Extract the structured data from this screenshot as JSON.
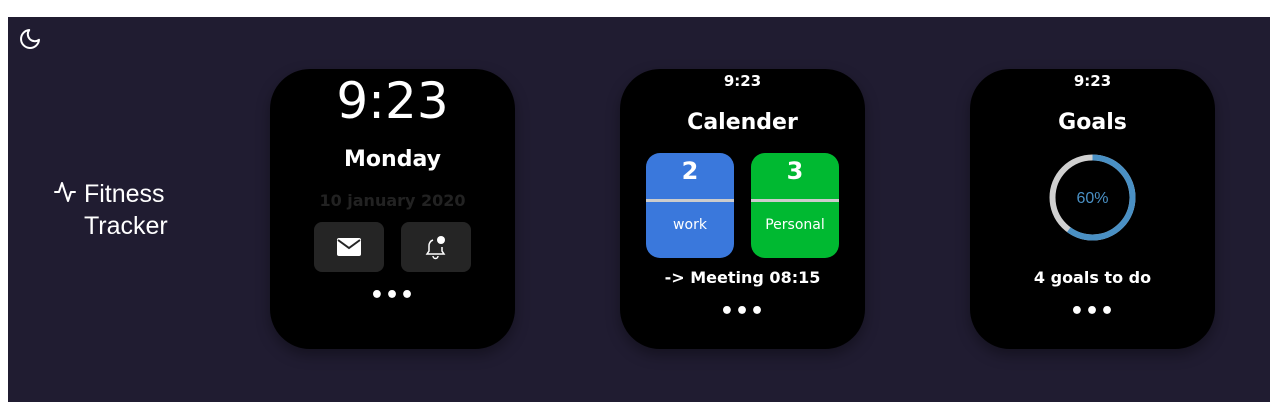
{
  "brand": {
    "title": "Fitness Tracker",
    "icon": "activity-icon"
  },
  "theme_toggle": {
    "icon": "moon-icon"
  },
  "colors": {
    "background": "#201c31",
    "work": "#3a78dc",
    "personal": "#00b931",
    "progress": "#4a90c4",
    "track": "#d0d0d0"
  },
  "home": {
    "time": "9:23",
    "day": "Monday",
    "date": "10 january 2020",
    "mail_icon": "mail-icon",
    "bell_icon": "bell-notification-icon",
    "more": "•••"
  },
  "calendar": {
    "time": "9:23",
    "title": "Calender",
    "work_count": "2",
    "work_label": "work",
    "personal_count": "3",
    "personal_label": "Personal",
    "next": "-> Meeting 08:15",
    "more": "•••"
  },
  "goals": {
    "time": "9:23",
    "title": "Goals",
    "progress_percent": 60,
    "progress_label": "60%",
    "summary": "4 goals to do",
    "more": "•••"
  }
}
